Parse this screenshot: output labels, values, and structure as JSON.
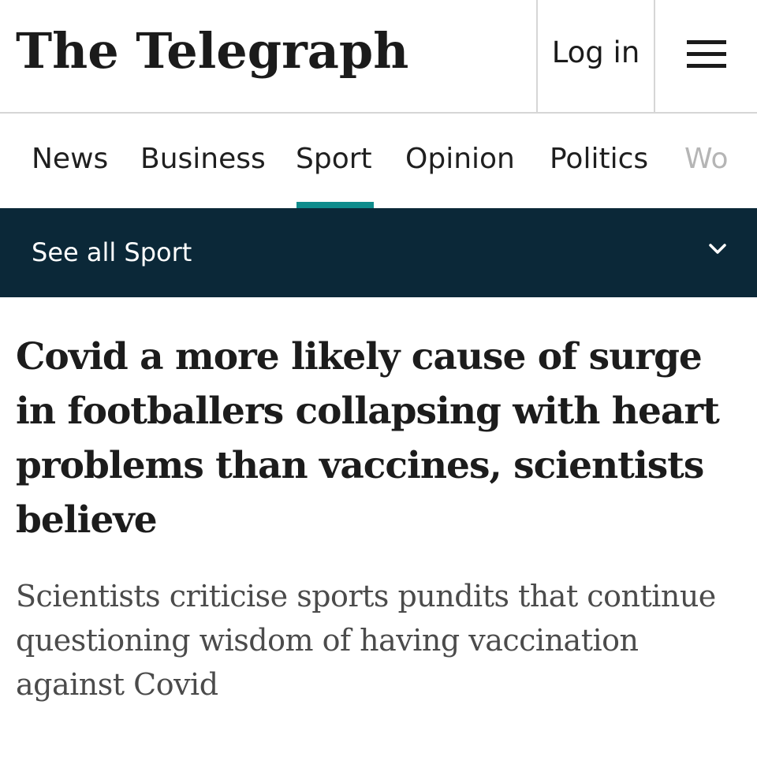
{
  "masthead": {
    "logo_text": "The Telegraph",
    "login_label": "Log in",
    "menu_icon": "hamburger-menu-icon"
  },
  "primary_nav": {
    "items": [
      {
        "label": "News"
      },
      {
        "label": "Business"
      },
      {
        "label": "Sport",
        "active": true
      },
      {
        "label": "Opinion"
      },
      {
        "label": "Politics"
      },
      {
        "label": "Wo"
      }
    ],
    "active_underline_color": "#0f8c8c"
  },
  "subnav": {
    "label": "See all Sport",
    "icon": "chevron-down-icon",
    "background_color": "#0b2838"
  },
  "article": {
    "headline": "Covid a more likely cause of surge in footballers collapsing with heart problems than vaccines, scientists believe",
    "standfirst": "Scientists criticise sports pundits that continue questioning wisdom of having vaccination against Covid"
  }
}
